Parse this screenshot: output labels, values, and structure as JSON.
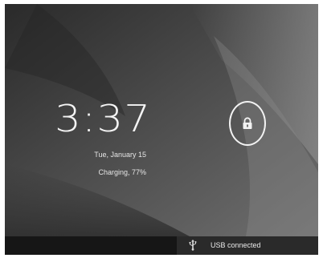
{
  "lockscreen": {
    "time": "3:37",
    "date": "Tue, January 15",
    "charging": "Charging, 77%",
    "unlock_icon": "lock-icon"
  },
  "statusbar": {
    "notification_icon": "usb-icon",
    "notification_text": "USB connected"
  },
  "colors": {
    "status_bar": "#1a1a1a",
    "text": "#f4f4f4",
    "ring": "#f2f2f2"
  }
}
